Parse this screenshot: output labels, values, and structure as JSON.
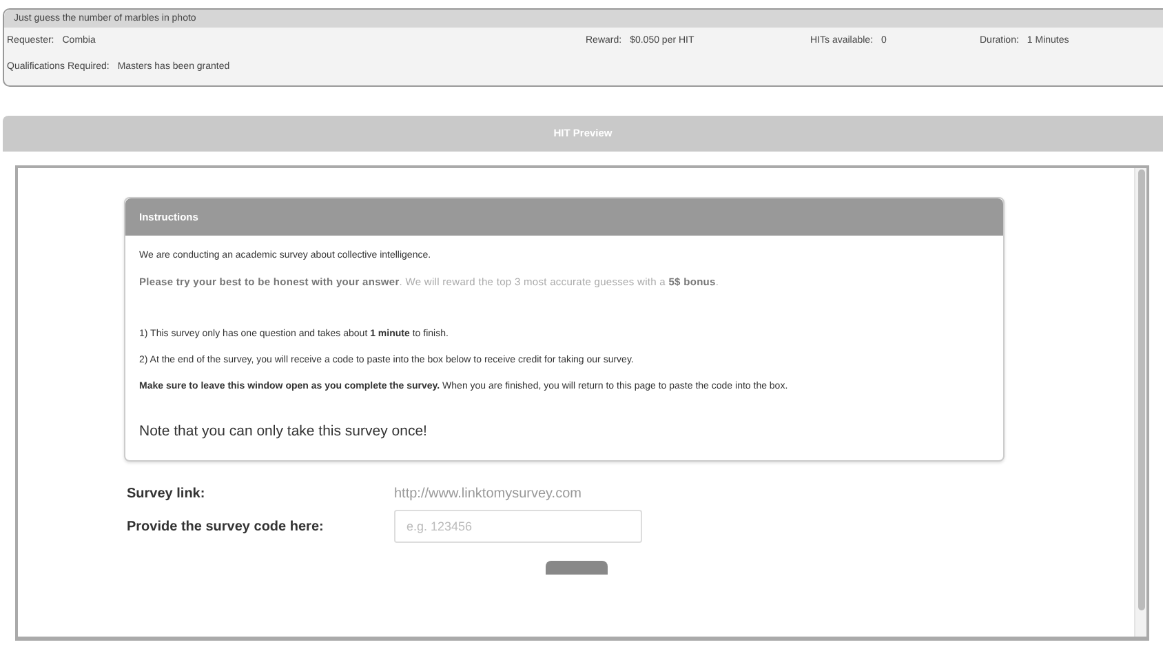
{
  "hit": {
    "title": "Just guess the number of marbles in photo",
    "fields": [
      {
        "label": "Requester:",
        "value": "Combia"
      },
      {
        "label": "Reward:",
        "value": "$0.050 per HIT"
      },
      {
        "label": "HITs available:",
        "value": "0"
      },
      {
        "label": "Duration:",
        "value": "1 Minutes"
      }
    ],
    "qualifications": {
      "label": "Qualifications Required:",
      "value": "Masters has been granted"
    }
  },
  "preview": {
    "title": "HIT Preview",
    "instructions": {
      "title": "Instructions",
      "paragraphs": [
        {
          "kind": "plain",
          "text": "We are conducting an academic survey about collective intelligence."
        },
        {
          "kind": "emphasis",
          "text": "**Please try your best to be honest with your answer**. We will reward the top 3 most accurate guesses with a **5$ bonus**."
        },
        {
          "kind": "plain",
          "text": "1) This survey only has one question and takes about **1 minute** to finish."
        },
        {
          "kind": "plain",
          "text": "2) At the end of the survey, you will receive a code to paste into the box below to receive credit for taking our survey."
        },
        {
          "kind": "plain",
          "text": "**Make sure to leave this window open as you complete the survey.** When you are finished, you will return to this page to paste the code into the box."
        },
        {
          "kind": "note",
          "text": "Note that you can only take this survey once!"
        }
      ]
    },
    "survey_link": {
      "label": "Survey link:",
      "value": "http://www.linktomysurvey.com"
    },
    "code_field": {
      "label": "Provide the survey code here:",
      "placeholder": "e.g. 123456"
    }
  }
}
